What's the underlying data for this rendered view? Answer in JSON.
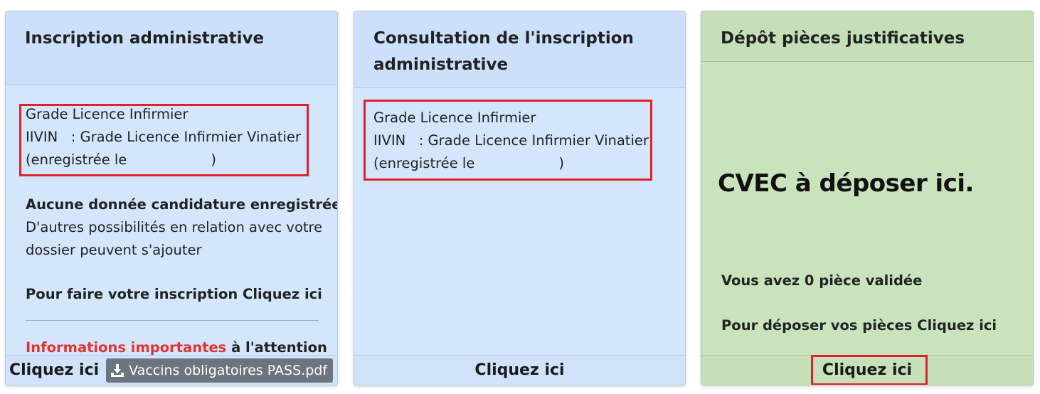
{
  "cards": {
    "inscription": {
      "title": "Inscription administrative",
      "program_name": "Grade Licence Infirmier",
      "program_code_line": "IIVIN   : Grade Licence Infirmier Vinatier",
      "registered_prefix": "(enregistrée le",
      "registered_suffix": ")",
      "no_data_title": "Aucune donnée candidature enregistrée",
      "no_data_text_1": "D'autres possibilités en relation avec votre",
      "no_data_text_2": "dossier peuvent s'ajouter",
      "cta_text": "Pour faire votre inscription Cliquez ici",
      "important_link": "Informations importantes",
      "important_suffix": " à l'attention",
      "footer_link": "Cliquez ici",
      "pdf_button_label": "Vaccins obligatoires PASS.pdf",
      "pdf_icon": "download-icon"
    },
    "consultation": {
      "title_line_1": "Consultation de l'inscription",
      "title_line_2": "administrative",
      "program_name": "Grade Licence Infirmier",
      "program_code_line": "IIVIN   : Grade Licence Infirmier Vinatier",
      "registered_prefix": "(enregistrée le",
      "registered_suffix": ")",
      "footer_link": "Cliquez ici"
    },
    "depot": {
      "title": "Dépôt pièces justificatives",
      "cvec_annotation": "CVEC à déposer ici.",
      "validated_text": "Vous avez 0 pièce validée",
      "cta_text": "Pour déposer vos pièces Cliquez ici",
      "footer_link": "Cliquez ici"
    }
  },
  "colors": {
    "blue_card_bg": "#d4e6fc",
    "green_card_bg": "#c9e3bd",
    "highlight_red": "#e0202a",
    "link_red": "#e3342f",
    "pdf_button_bg": "#6c757d"
  }
}
